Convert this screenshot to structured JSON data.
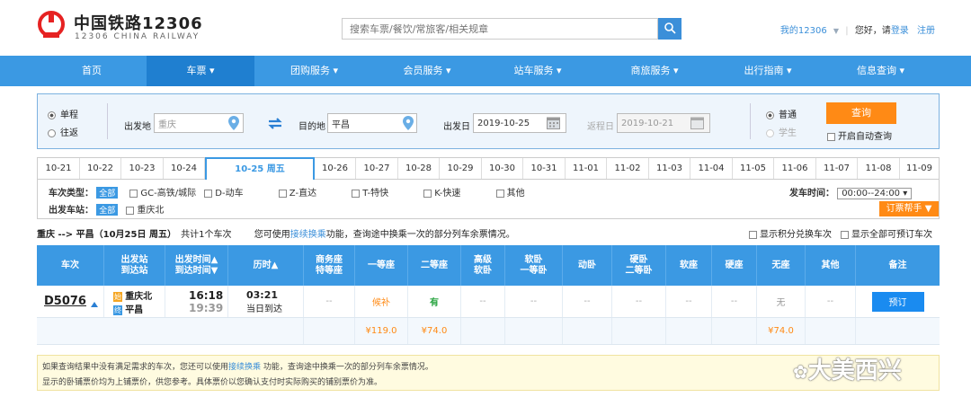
{
  "brand": {
    "name": "中国铁路12306",
    "sub": "12306 CHINA RAILWAY"
  },
  "search": {
    "placeholder": "搜索车票/餐饮/常旅客/相关规章"
  },
  "top_links": {
    "my": "我的12306",
    "arrow": "▼",
    "greeting": "您好，请",
    "login": "登录",
    "register": "注册"
  },
  "nav": [
    "首页",
    "车票 ▾",
    "团购服务 ▾",
    "会员服务 ▾",
    "站车服务 ▾",
    "商旅服务 ▾",
    "出行指南 ▾",
    "信息查询 ▾"
  ],
  "trip_type": {
    "one_way": "单程",
    "round": "往返"
  },
  "from": {
    "label": "出发地",
    "value": "重庆"
  },
  "to": {
    "label": "目的地",
    "value": "平昌"
  },
  "depart": {
    "label": "出发日",
    "value": "2019-10-25"
  },
  "return_date": {
    "label": "返程日",
    "value": "2019-10-21"
  },
  "passenger": {
    "normal": "普通",
    "student": "学生"
  },
  "query_label": "查询",
  "auto_query": "开启自动查询",
  "dates": [
    "10-21",
    "10-22",
    "10-23",
    "10-24",
    "10-25 周五",
    "10-26",
    "10-27",
    "10-28",
    "10-29",
    "10-30",
    "10-31",
    "11-01",
    "11-02",
    "11-03",
    "11-04",
    "11-05",
    "11-06",
    "11-07",
    "11-08",
    "11-09"
  ],
  "filters": {
    "type_label": "车次类型：",
    "all": "全部",
    "types": [
      "GC-高铁/城际",
      "D-动车",
      "Z-直达",
      "T-特快",
      "K-快速",
      "其他"
    ],
    "station_label": "出发车站：",
    "stations": [
      "重庆北"
    ],
    "time_label": "发车时间：",
    "time_value": "00:00--24:00",
    "helper": "订票帮手 ▼"
  },
  "route": {
    "summary": "重庆 --> 平昌（10月25日  周五）",
    "count": "共计1个车次",
    "hint_pre": "您可使用",
    "hint_link": "接续换乘",
    "hint_post": "功能，查询途中换乘一次的部分列车余票情况。",
    "opt1": "显示积分兑换车次",
    "opt2": "显示全部可预订车次"
  },
  "columns": [
    "车次",
    "出发站\n到达站",
    "出发时间▲\n到达时间▼",
    "历时▲",
    "商务座\n特等座",
    "一等座",
    "二等座",
    "高级\n软卧",
    "软卧\n一等卧",
    "动卧",
    "硬卧\n二等卧",
    "软座",
    "硬座",
    "无座",
    "其他",
    "备注"
  ],
  "train": {
    "no": "D5076",
    "from": "重庆北",
    "to": "平昌",
    "from_tag": "始",
    "to_tag": "终",
    "dep": "16:18",
    "arr": "19:39",
    "dur": "03:21",
    "dur_note": "当日到达",
    "business": "--",
    "first": "候补",
    "second": "有",
    "adv_soft": "--",
    "soft_sleep": "--",
    "moving": "--",
    "hard_sleep": "--",
    "soft_seat": "--",
    "hard_seat": "--",
    "no_seat": "无",
    "other": "--",
    "book": "预订",
    "price_first": "¥119.0",
    "price_second": "¥74.0",
    "price_noseat": "¥74.0"
  },
  "note": {
    "line1_pre": "如果查询结果中没有满足需求的车次，您还可以使用",
    "line1_link": "接续换乘",
    "line1_post": " 功能，查询途中换乘一次的部分列车余票情况。",
    "line2": "显示的卧铺票价均为上铺票价，供您参考。具体票价以您确认支付时实际购买的铺别票价为准。"
  },
  "watermark": "大美西兴",
  "colors": {
    "nav": "#3b99e3",
    "accent": "#ff8a15",
    "link": "#3b8fd9"
  }
}
